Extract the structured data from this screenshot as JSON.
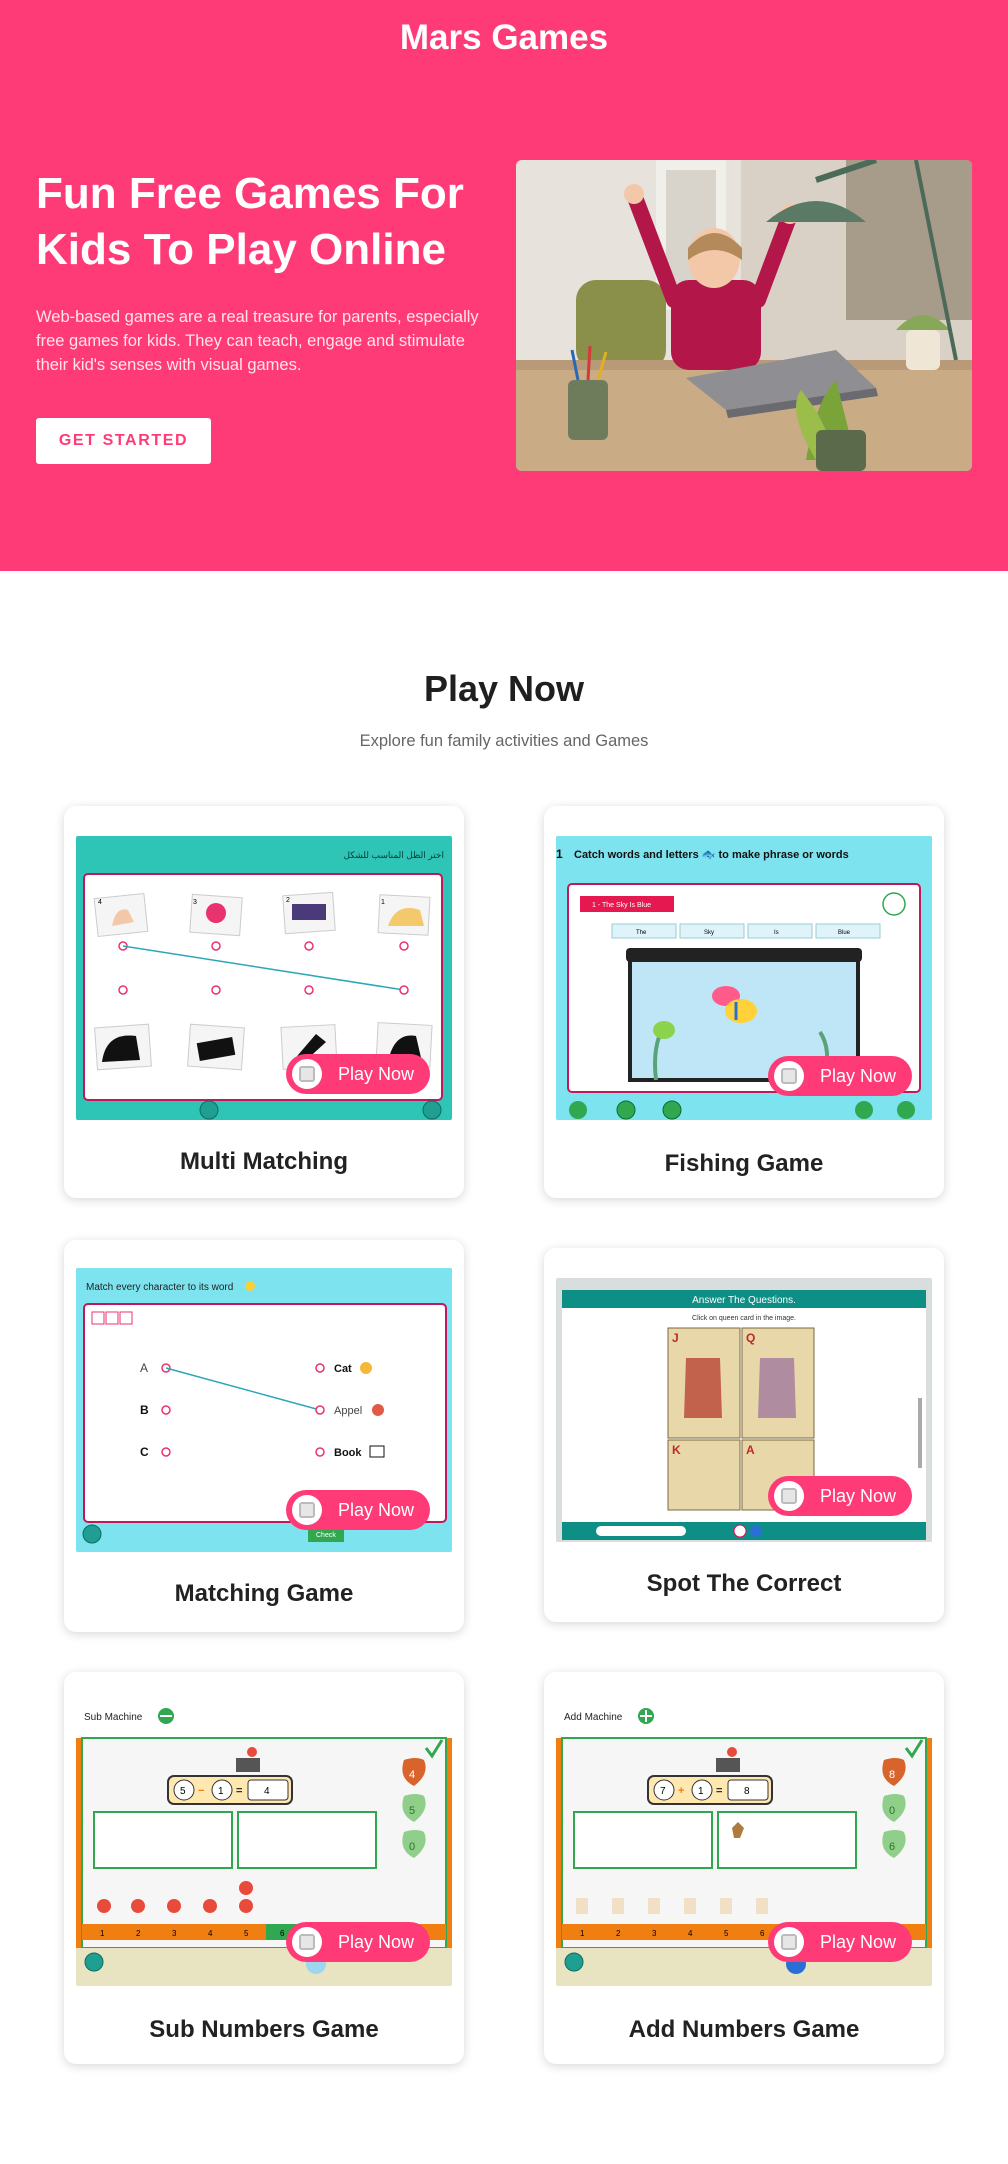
{
  "site": {
    "brand": "Mars Games"
  },
  "hero": {
    "title": "Fun Free Games For Kids To Play Online",
    "description": "Web-based games are a real treasure for parents, especially free games for kids. They can teach, engage and stimulate their kid's senses with visual games.",
    "cta_label": "GET STARTED"
  },
  "section": {
    "title": "Play Now",
    "subtitle": "Explore fun family activities and Games"
  },
  "play_label": "Play Now",
  "games": [
    {
      "title": "Multi Matching",
      "screen": {
        "header": "اختر الظل المناسب للشكل",
        "numbers": [
          "4",
          "3",
          "2",
          "1"
        ]
      }
    },
    {
      "title": "Fishing Game",
      "screen": {
        "number": "1",
        "instruction": "Catch words and letters 🐟 to make phrase or words",
        "level": "1 - The Sky Is Blue",
        "words": [
          "The",
          "Sky",
          "Is",
          "Blue"
        ]
      }
    },
    {
      "title": "Matching Game",
      "screen": {
        "instruction": "Match every character to its word",
        "letters": [
          "A",
          "B",
          "C"
        ],
        "words": [
          "Cat",
          "Appel",
          "Book"
        ],
        "check": "Check"
      }
    },
    {
      "title": "Spot The Correct",
      "screen": {
        "header": "Answer The Questions.",
        "question": "Click on queen card in the image."
      }
    },
    {
      "title": "Sub Numbers Game",
      "screen": {
        "label": "Sub Machine",
        "operand_a": "5",
        "operator": "−",
        "operand_b": "1",
        "result": "4",
        "answers": [
          "4",
          "5",
          "0"
        ],
        "scale": [
          "1",
          "2",
          "3",
          "4",
          "5",
          "6",
          "7",
          "8"
        ]
      }
    },
    {
      "title": "Add Numbers Game",
      "screen": {
        "label": "Add Machine",
        "operand_a": "7",
        "operator": "+",
        "operand_b": "1",
        "result": "8",
        "answers": [
          "8",
          "0",
          "6"
        ],
        "scale": [
          "1",
          "2",
          "3",
          "4",
          "5",
          "6",
          "7",
          "8"
        ]
      }
    }
  ],
  "colors": {
    "brand_pink": "#ff3b77",
    "teal": "#2ec4b6",
    "sky": "#7de3ee",
    "dark_teal": "#0e8f86",
    "orange": "#f07e10",
    "green": "#2fa84f"
  }
}
